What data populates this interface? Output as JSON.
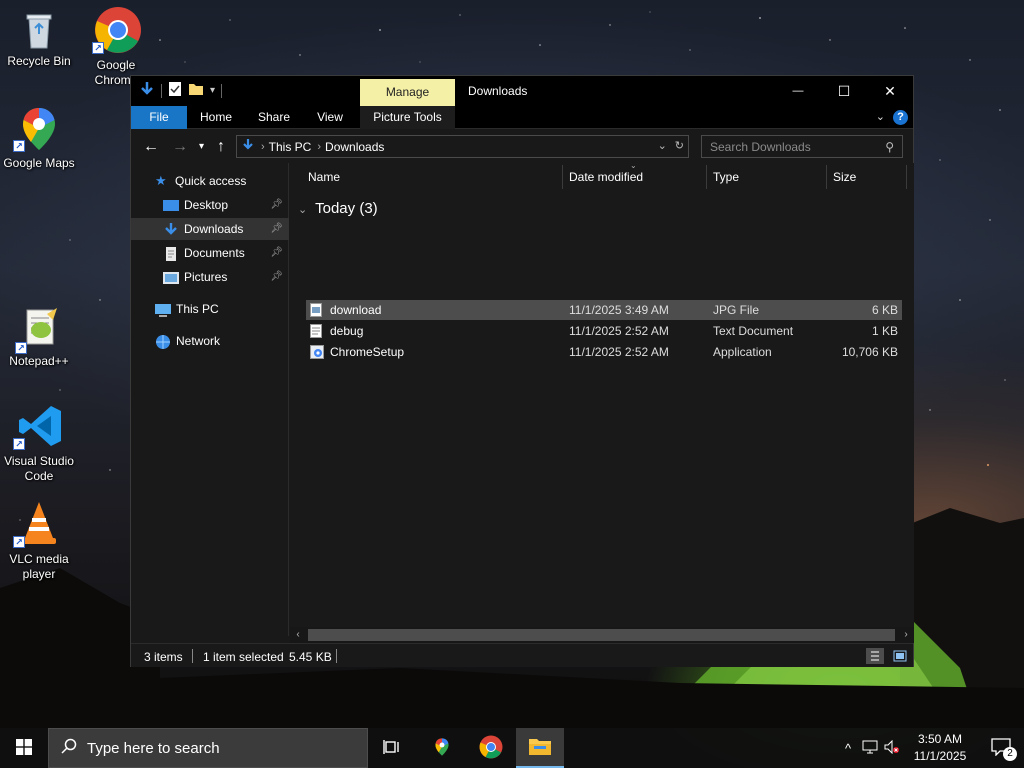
{
  "desktop": {
    "icons": [
      {
        "label": "Recycle Bin",
        "icon": "recycle-bin-icon"
      },
      {
        "label": "Google Chrome",
        "icon": "chrome-icon"
      },
      {
        "label": "Google Maps",
        "icon": "google-maps-icon"
      },
      {
        "label": "Notepad++",
        "icon": "notepad-plus-plus-icon"
      },
      {
        "label": "Visual Studio Code",
        "icon": "vscode-icon"
      },
      {
        "label": "VLC media player",
        "icon": "vlc-icon"
      }
    ]
  },
  "window": {
    "title": "Downloads",
    "contextual_tab": "Manage",
    "controls": {
      "minimize": "—",
      "maximize": "☐",
      "close": "✕"
    }
  },
  "ribbon": {
    "tabs": [
      "File",
      "Home",
      "Share",
      "View",
      "Picture Tools"
    ]
  },
  "address": {
    "breadcrumbs": [
      "This PC",
      "Downloads"
    ],
    "search_placeholder": "Search Downloads"
  },
  "nav": {
    "quick_access": "Quick access",
    "items": [
      {
        "label": "Desktop",
        "icon": "desktop-folder-icon",
        "pinned": true
      },
      {
        "label": "Downloads",
        "icon": "downloads-folder-icon",
        "pinned": true,
        "selected": true
      },
      {
        "label": "Documents",
        "icon": "documents-folder-icon",
        "pinned": true
      },
      {
        "label": "Pictures",
        "icon": "pictures-folder-icon",
        "pinned": true
      }
    ],
    "this_pc": "This PC",
    "network": "Network"
  },
  "list": {
    "columns": [
      "Name",
      "Date modified",
      "Type",
      "Size"
    ],
    "group": "Today (3)",
    "files": [
      {
        "name": "download",
        "date": "11/1/2025 3:49 AM",
        "type": "JPG File",
        "size": "6 KB",
        "selected": true,
        "icon": "jpg-file-icon"
      },
      {
        "name": "debug",
        "date": "11/1/2025 2:52 AM",
        "type": "Text Document",
        "size": "1 KB",
        "icon": "text-file-icon"
      },
      {
        "name": "ChromeSetup",
        "date": "11/1/2025 2:52 AM",
        "type": "Application",
        "size": "10,706 KB",
        "icon": "installer-icon"
      }
    ]
  },
  "status": {
    "item_count": "3 items",
    "selection": "1 item selected",
    "selection_size": "5.45 KB"
  },
  "taskbar": {
    "search_placeholder": "Type here to search",
    "time": "3:50 AM",
    "date": "11/1/2025",
    "notification_count": "2"
  },
  "colors": {
    "accent": "#1975c5",
    "manage_tab": "#f4f0a6",
    "selection": "#4d4d4d"
  }
}
